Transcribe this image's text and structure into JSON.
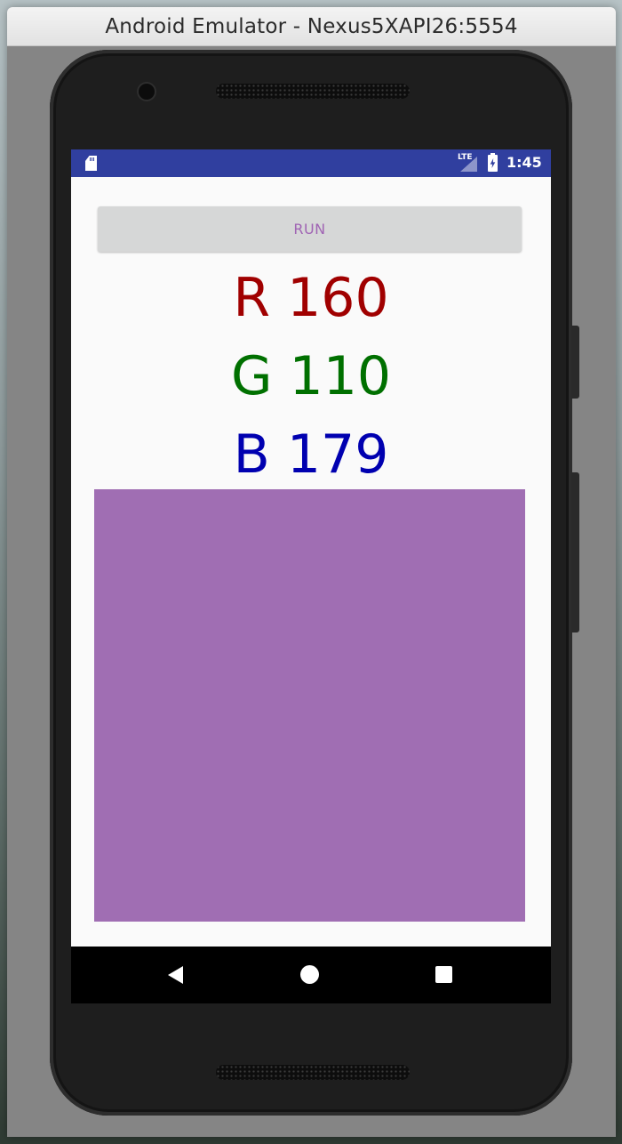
{
  "window": {
    "title": "Android Emulator - Nexus5XAPI26:5554"
  },
  "status_bar": {
    "network_label": "LTE",
    "time": "1:45",
    "background_color": "#303f9f",
    "icons": [
      "sd-card-icon",
      "signal-icon",
      "battery-charging-icon"
    ]
  },
  "app": {
    "run_button_label": "RUN",
    "red_line": "R 160",
    "green_line": "G 110",
    "blue_line": "B 179",
    "red_text_color": "#a00000",
    "green_text_color": "#007000",
    "blue_text_color": "#0000b0",
    "swatch_color": "#a06eb3"
  },
  "nav_bar": {
    "icons": [
      "back-icon",
      "home-icon",
      "recents-icon"
    ]
  }
}
